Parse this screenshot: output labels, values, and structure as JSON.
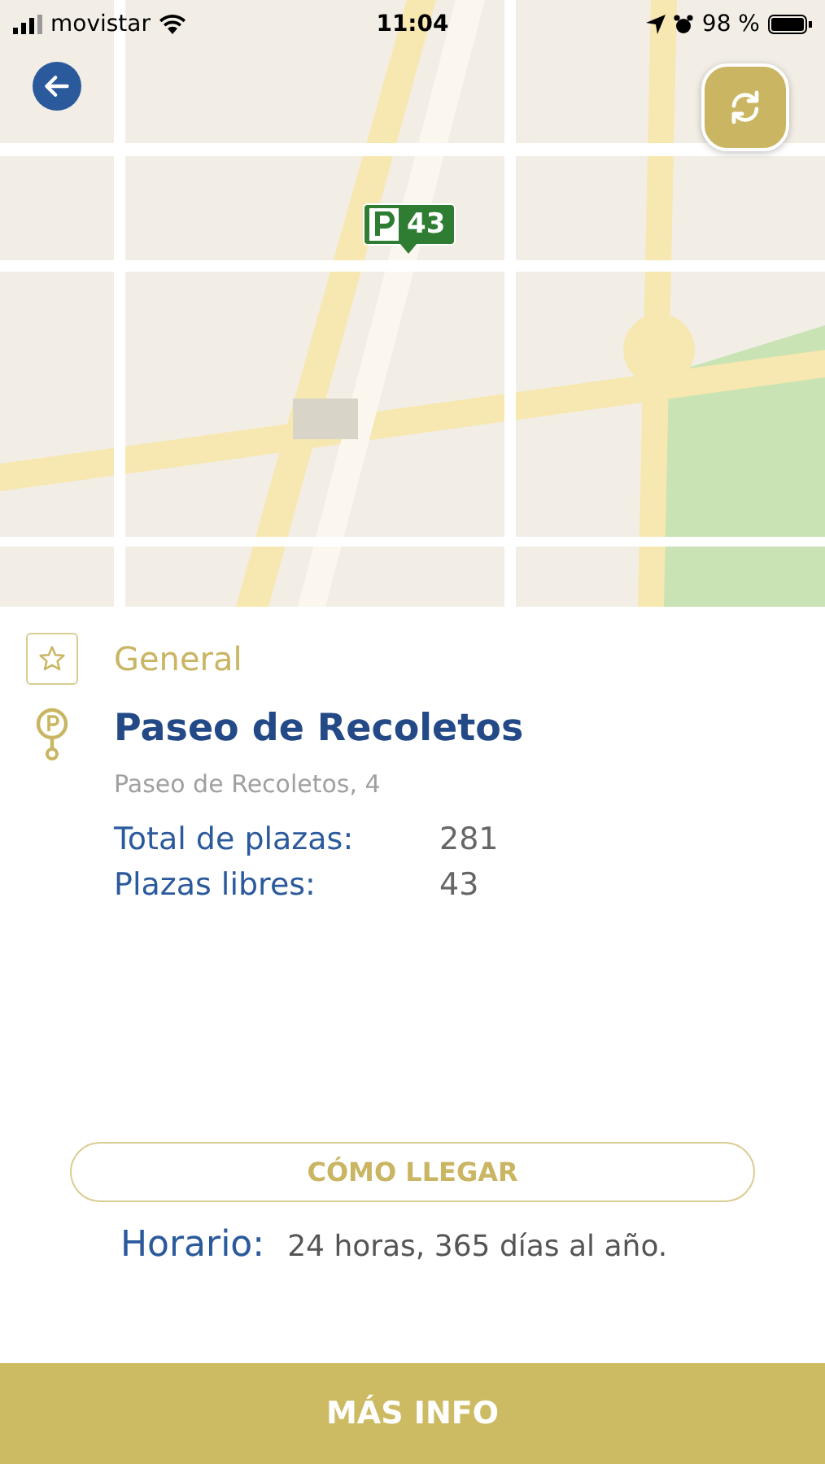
{
  "status_bar": {
    "carrier": "movistar",
    "time": "11:04",
    "battery": "98 %"
  },
  "map": {
    "kind": "picture",
    "marker": {
      "count": "43"
    }
  },
  "category": {
    "label": "General"
  },
  "parking": {
    "name": "Paseo de Recoletos",
    "address": "Paseo de Recoletos, 4",
    "stats": [
      {
        "label": "Total de plazas:",
        "value": "281"
      },
      {
        "label": "Plazas libres:",
        "value": "43"
      }
    ]
  },
  "directions_button": "CÓMO LLEGAR",
  "schedule": {
    "label": "Horario:",
    "value": "24 horas, 365 días al año."
  },
  "more_button": "MÁS INFO"
}
